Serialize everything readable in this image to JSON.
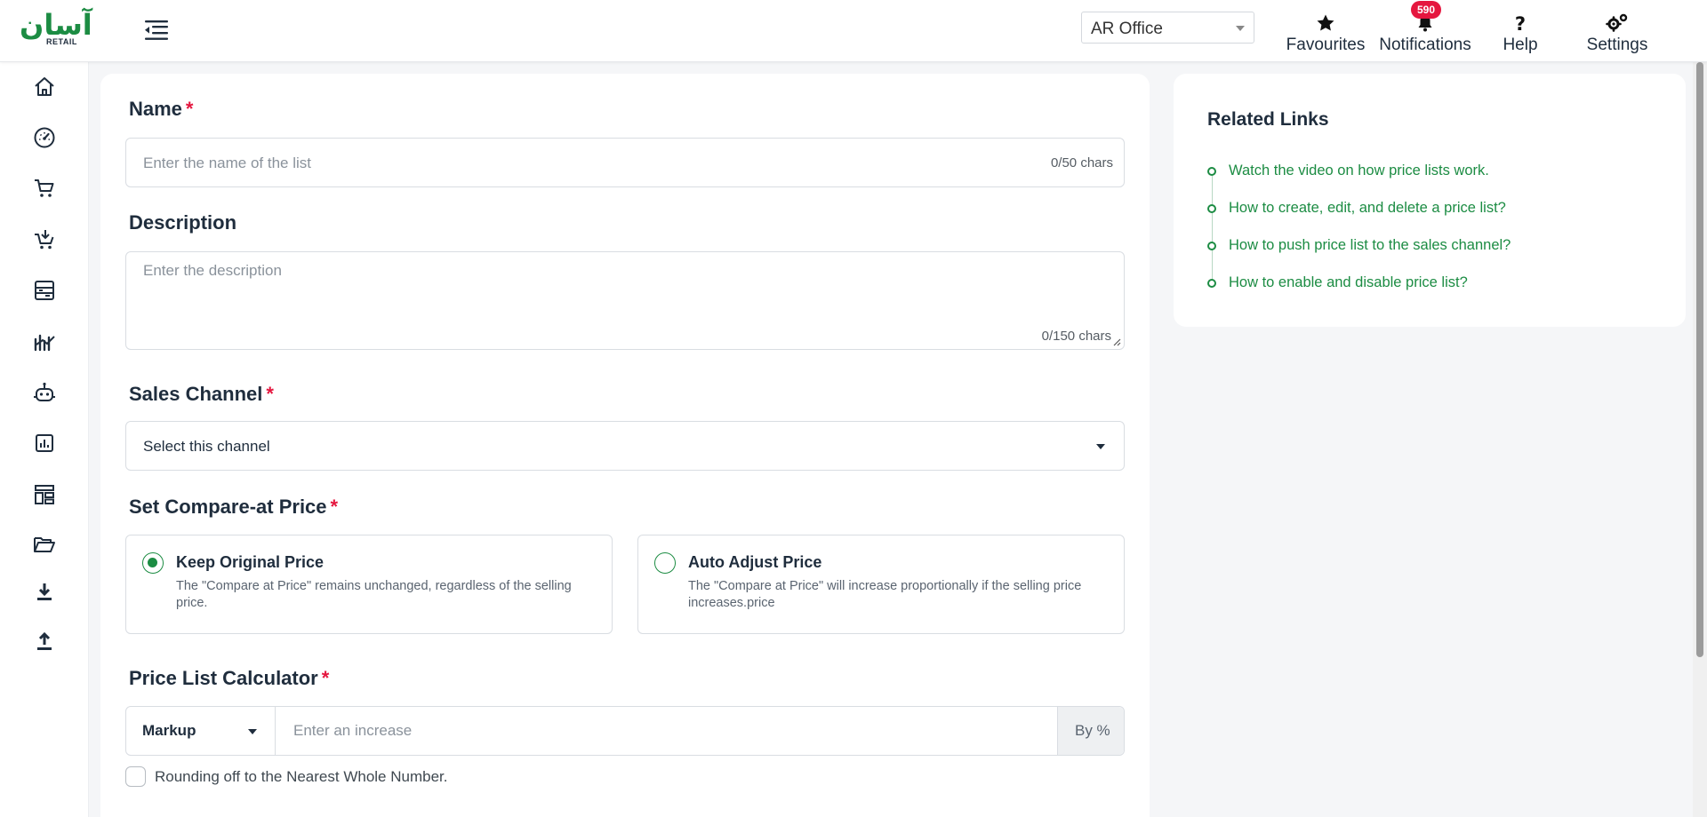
{
  "app": {
    "logo_ar": "آسان",
    "logo_en": "RETAIL"
  },
  "header": {
    "office_select": {
      "value": "AR Office"
    },
    "actions": {
      "favourites": "Favourites",
      "notifications": "Notifications",
      "notifications_count": "590",
      "help": "Help",
      "settings": "Settings"
    }
  },
  "sidebar": {
    "items": [
      {
        "icon": "home-icon"
      },
      {
        "icon": "dashboard-gauge-icon"
      },
      {
        "icon": "cart-icon"
      },
      {
        "icon": "cart-add-icon"
      },
      {
        "icon": "inventory-icon"
      },
      {
        "icon": "sales-chart-icon"
      },
      {
        "icon": "robot-icon"
      },
      {
        "icon": "report-chart-icon"
      },
      {
        "icon": "layout-icon"
      },
      {
        "icon": "folder-open-icon"
      },
      {
        "icon": "download-icon"
      },
      {
        "icon": "upload-icon"
      }
    ]
  },
  "form": {
    "name": {
      "label": "Name",
      "required_mark": "*",
      "placeholder": "Enter the name of the list",
      "counter": "0/50 chars"
    },
    "description": {
      "label": "Description",
      "placeholder": "Enter the description",
      "counter": "0/150 chars"
    },
    "sales_channel": {
      "label": "Sales Channel",
      "required_mark": "*",
      "value": "Select this channel"
    },
    "compare_at_price": {
      "label": "Set Compare-at Price",
      "required_mark": "*",
      "options": [
        {
          "title": "Keep Original Price",
          "description": "The \"Compare at Price\" remains unchanged, regardless of the selling price.",
          "selected": true
        },
        {
          "title": "Auto Adjust Price",
          "description": "The \"Compare at Price\" will increase proportionally if the selling price increases.price",
          "selected": false
        }
      ]
    },
    "calculator": {
      "label": "Price List Calculator",
      "required_mark": "*",
      "mode": "Markup",
      "placeholder": "Enter an increase",
      "suffix": "By %"
    },
    "rounding": {
      "label": "Rounding off to the Nearest Whole Number.",
      "checked": false
    }
  },
  "related_links": {
    "title": "Related Links",
    "links": [
      "Watch the video on how price lists work.",
      "How to create, edit, and delete a price list?",
      "How to push price list to the sales channel?",
      "How to enable and disable price list?"
    ]
  },
  "colors": {
    "brand": "#1c8c43",
    "required": "#e5173f",
    "badge": "#e5173f"
  }
}
